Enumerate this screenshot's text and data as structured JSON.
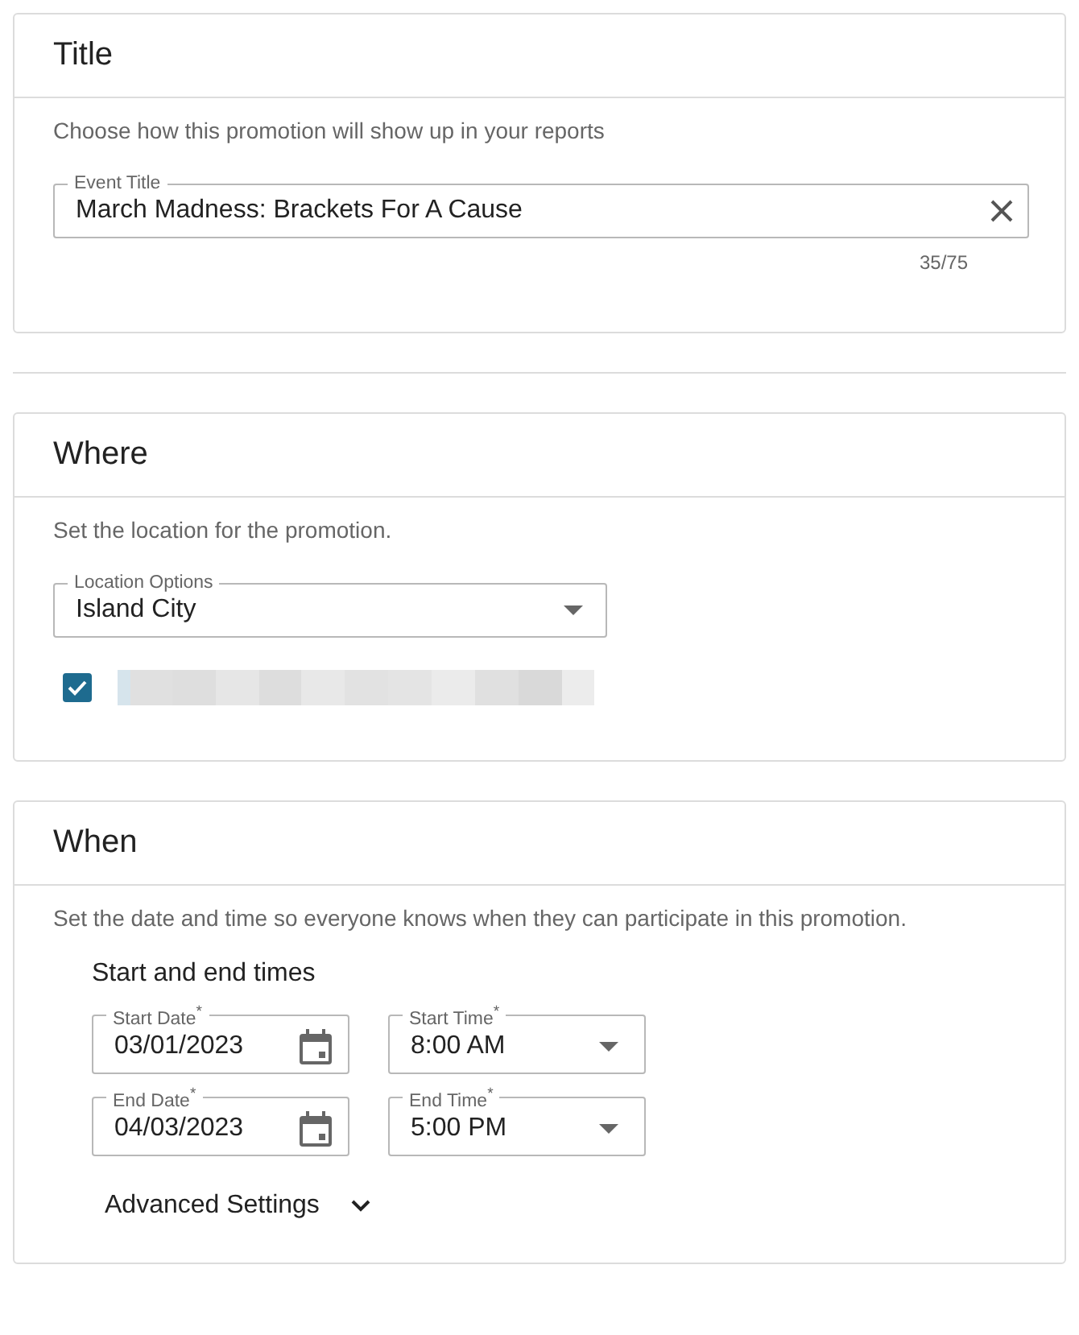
{
  "sections": [
    {
      "kind": "title",
      "heading": "Title",
      "description": "Choose how this promotion will show up in your reports",
      "field": {
        "label": "Event Title",
        "value": "March Madness: Brackets For A Cause"
      },
      "counter": "35/75"
    },
    {
      "kind": "where",
      "heading": "Where",
      "description": "Set the location for the promotion.",
      "field": {
        "label": "Location Options",
        "value": "Island City"
      },
      "checkbox": {
        "checked": true
      }
    },
    {
      "kind": "when",
      "heading": "When",
      "description": "Set the date and time so everyone knows when they can participate in this promotion.",
      "subheading": "Start and end times",
      "rows": [
        [
          {
            "kind": "date",
            "label": "Start Date$^{*}$",
            "value": "03/01/2023"
          },
          {
            "kind": "time",
            "label": "Start Time$^{*}$",
            "value": "8:00 AM"
          }
        ],
        [
          {
            "kind": "date",
            "label": "End Date$^{*}$",
            "value": "04/03/2023"
          },
          {
            "kind": "time",
            "label": "End Time$^{*}$",
            "value": "5:00 PM"
          }
        ]
      ],
      "advanced": {
        "label": "Advanced Settings",
        "expanded": false
      }
    }
  ]
}
